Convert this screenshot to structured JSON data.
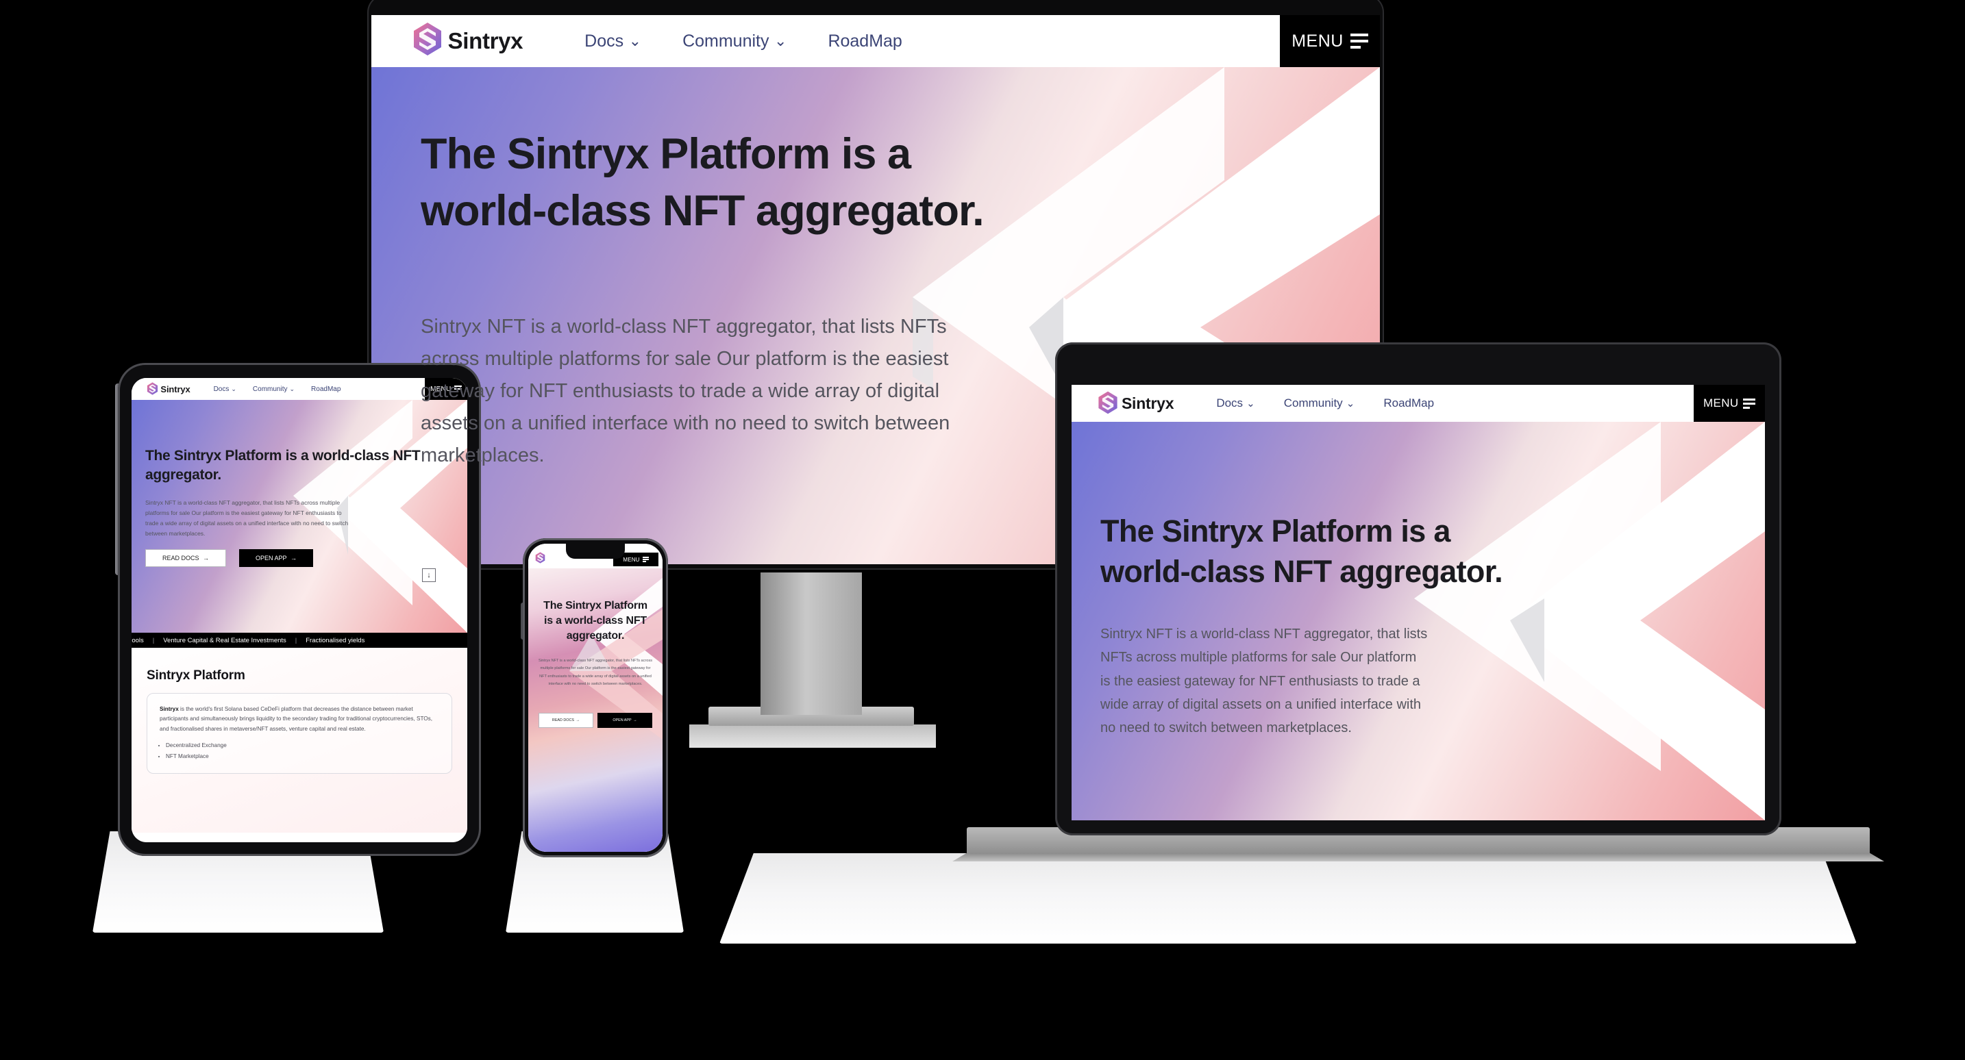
{
  "brand": {
    "name": "Sintryx",
    "logo_icon": "sintryx-hexagon-logo-icon",
    "accent_start": "#f0728f",
    "accent_end": "#6a63d6"
  },
  "nav": {
    "links": [
      {
        "label": "Docs",
        "has_dropdown": true,
        "chevron": "⌄"
      },
      {
        "label": "Community",
        "has_dropdown": true,
        "chevron": "⌄"
      },
      {
        "label": "RoadMap",
        "has_dropdown": false,
        "chevron": ""
      }
    ],
    "menu_label": "MENU",
    "menu_icon": "hamburger-menu-icon"
  },
  "hero": {
    "heading": "The Sintryx Platform is a world-class NFT aggregator.",
    "paragraph": "Sintryx NFT is a world-class NFT aggregator, that lists NFTs across multiple platforms for sale Our platform is the easiest gateway for NFT enthusiasts to trade a wide array of digital assets on a unified interface with no need to switch between marketplaces.",
    "primary_button": "OPEN APP",
    "secondary_button": "READ DOCS",
    "button_arrow": "→",
    "scroll_indicator": "↓",
    "gradient_left": "#6f74d6",
    "gradient_mid": "#f3e2e4",
    "gradient_right": "#f19fa3",
    "chevron_shape_color": "#ffffff"
  },
  "ticker": {
    "items": [
      "Pools",
      "Venture Capital & Real Estate Investments",
      "Fractionalised yields"
    ],
    "separator": "|"
  },
  "platform_section": {
    "title": "Sintryx Platform",
    "lead_bold": "Sintryx",
    "lead_rest": " is the world's first Solana based CeDeFi platform that decreases the distance between market participants and simultaneously brings liquidity to the secondary trading for traditional cryptocurrencies, STOs, and fractionalised shares in metaverse/NFT assets, venture capital and real estate.",
    "bullets": [
      "Decentralized Exchange",
      "NFT Marketplace"
    ]
  },
  "devices": {
    "monitor": "desktop-monitor",
    "laptop": "laptop",
    "tablet": "tablet",
    "phone": "smartphone"
  }
}
